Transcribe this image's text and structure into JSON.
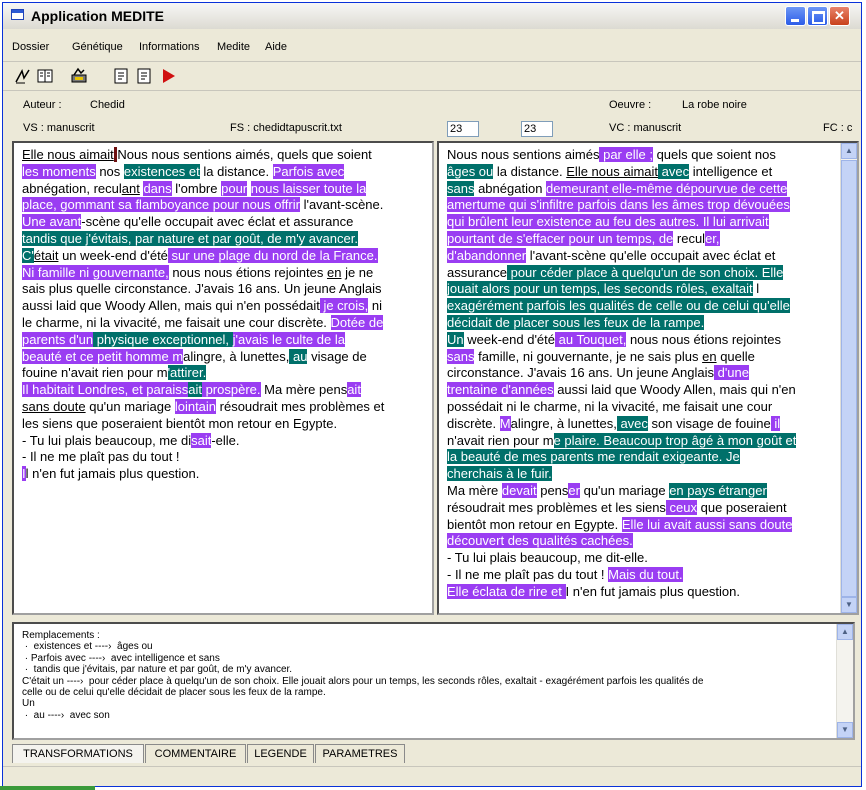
{
  "window": {
    "title": "Application MEDITE",
    "controls": [
      "_",
      "□",
      "X"
    ]
  },
  "menu": [
    "Dossier",
    "Génétique",
    "Informations",
    "Medite",
    "Aide"
  ],
  "toolbar": [
    "tool-align",
    "tool-book",
    "tool-wrench",
    "tool-doc-a",
    "tool-doc-b",
    "play-icon"
  ],
  "info": {
    "auteur_label": "Auteur :",
    "auteur_value": "Chedid",
    "oeuvre_label": "Oeuvre :",
    "oeuvre_value": "La robe noire",
    "vs": "VS : manuscrit",
    "fs": "FS : chedidtapuscrit.txt",
    "input1": "23",
    "input2": "23",
    "vc": "VC : manuscrit",
    "fc": "FC : c"
  },
  "colors": {
    "purple": "#9a3df2",
    "teal": "#00706a"
  },
  "left_text": [
    [
      [
        "Elle nous aimait",
        "u"
      ],
      [
        " ",
        "h"
      ],
      [
        "Nous nous sentions aimés, quels que soient",
        ""
      ]
    ],
    [
      [
        "les moments",
        "p"
      ],
      [
        " nos ",
        ""
      ],
      [
        "existences et",
        "t"
      ],
      [
        " la distance. ",
        ""
      ],
      [
        "Parfois avec",
        "p"
      ]
    ],
    [
      [
        "abnégation, recul",
        ""
      ],
      [
        "ant",
        "u"
      ],
      [
        " ",
        ""
      ],
      [
        "dans",
        "p"
      ],
      [
        " l'ombre ",
        ""
      ],
      [
        "pour",
        "p"
      ],
      [
        " ",
        ""
      ],
      [
        "nous laisser toute la",
        "p"
      ]
    ],
    [
      [
        "place, gommant sa flamboyance pour nous offrir",
        "p"
      ],
      [
        " l'avant-scène.",
        ""
      ]
    ],
    [
      [
        "Une avant",
        "p"
      ],
      [
        "-scène qu'elle occupait avec éclat et assurance",
        ""
      ]
    ],
    [
      [
        "tandis que j'évitais, par nature et par goût, de m'y avancer.",
        "t"
      ]
    ],
    [
      [
        "C'",
        "t"
      ],
      [
        "était",
        "u"
      ],
      [
        " un",
        ""
      ],
      [
        " week-end d'été",
        ""
      ],
      [
        " sur une plage du nord de la France.",
        "p"
      ]
    ],
    [
      [
        "Ni famille ni gouvernante,",
        "p"
      ],
      [
        " nous nous étions rejointes ",
        ""
      ],
      [
        "en",
        "u"
      ],
      [
        " je ne",
        ""
      ]
    ],
    [
      [
        "sais plus quelle circonstance. J'avais 16 ans. Un jeune Anglais",
        ""
      ]
    ],
    [
      [
        "aussi laid que Woody Allen, mais qui n'en possédait",
        ""
      ],
      [
        " je crois,",
        "p"
      ],
      [
        " ni",
        ""
      ]
    ],
    [
      [
        "le charme, ni la vivacité, me faisait une cour discrète. ",
        ""
      ],
      [
        "Dotée de",
        "p"
      ]
    ],
    [
      [
        "parents d'un",
        "p"
      ],
      [
        " physique exceptionnel, ",
        "t"
      ],
      [
        "j'avais le culte de la",
        "p"
      ]
    ],
    [
      [
        "beauté et ce petit homme m",
        "p"
      ],
      [
        "alingre, à lunettes,",
        ""
      ],
      [
        " au",
        "t"
      ],
      [
        " visage de",
        ""
      ]
    ],
    [
      [
        "fouine n'avait rien pour m",
        ""
      ],
      [
        "'attirer.",
        "t"
      ]
    ],
    [
      [
        "Il habitait Londres, et paraiss",
        "p"
      ],
      [
        "ait",
        "t"
      ],
      [
        " prospère.",
        "p"
      ],
      [
        " Ma mère pens",
        ""
      ],
      [
        "ait",
        "p"
      ]
    ],
    [
      [
        "sans doute",
        "u"
      ],
      [
        " qu'un mariage ",
        ""
      ],
      [
        "lointain",
        "p"
      ],
      [
        " résoudrait mes problèmes et",
        ""
      ]
    ],
    [
      [
        "les siens que poseraient bientôt mon retour en Egypte.",
        ""
      ]
    ],
    [
      [
        "- Tu lui plais beaucoup, me di",
        ""
      ],
      [
        "sait",
        "p"
      ],
      [
        "-elle.",
        ""
      ]
    ],
    [
      [
        "- Il ne me plaît pas du tout !",
        ""
      ]
    ],
    [
      [
        "I",
        "p"
      ],
      [
        "l n'en fut jamais plus question.",
        ""
      ]
    ]
  ],
  "right_text": [
    [
      [
        "Nous nous sentions aimés",
        ""
      ],
      [
        " par elle ;",
        "p"
      ],
      [
        " quels que soient nos",
        ""
      ]
    ],
    [
      [
        "âges ou",
        "t"
      ],
      [
        " la distance. ",
        ""
      ],
      [
        "Elle nous aimait",
        "u"
      ],
      [
        " avec",
        "t"
      ],
      [
        " intelligence et",
        ""
      ]
    ],
    [
      [
        "sans",
        "t"
      ],
      [
        " abnégation ",
        ""
      ],
      [
        "demeurant elle-même dépourvue de cette",
        "p"
      ]
    ],
    [
      [
        "amertume qui s'infiltre parfois dans les âmes trop dévouées",
        "p"
      ]
    ],
    [
      [
        "qui brûlent leur existence au feu des autres. Il lui arrivait",
        "p"
      ]
    ],
    [
      [
        "pourtant de s'effacer pour un temps, de",
        "p"
      ],
      [
        " recul",
        ""
      ],
      [
        "er,",
        "p"
      ]
    ],
    [
      [
        "d'abandonner",
        "p"
      ],
      [
        " l'avant-scène qu'elle occupait avec éclat et",
        ""
      ]
    ],
    [
      [
        "assurance",
        ""
      ],
      [
        " pour céder place à quelqu'un de son choix. Elle",
        "t"
      ]
    ],
    [
      [
        "jouait alors pour un temps, les seconds rôles, exaltait",
        "t"
      ],
      [
        " l",
        ""
      ]
    ],
    [
      [
        "exagérément parfois les qualités de celle ou de celui qu'elle",
        "t"
      ]
    ],
    [
      [
        "décidait de placer sous les feux de la rampe.",
        "t"
      ]
    ],
    [
      [
        "Un",
        "t"
      ],
      [
        " week-end d'été",
        ""
      ],
      [
        " au Touquet,",
        "p"
      ],
      [
        " nous nous étions rejointes",
        ""
      ]
    ],
    [
      [
        "sans",
        "p"
      ],
      [
        " famille, ni gouvernante,",
        ""
      ],
      [
        " je ne sais plus ",
        ""
      ],
      [
        "en",
        "u"
      ],
      [
        " quelle",
        ""
      ]
    ],
    [
      [
        "circonstance. J'avais 16 ans. Un jeune Anglais",
        ""
      ],
      [
        " d'une",
        "p"
      ]
    ],
    [
      [
        "trentaine d'années",
        "p"
      ],
      [
        " aussi laid que Woody Allen, mais qui n'en",
        ""
      ]
    ],
    [
      [
        "possédait ni le charme, ni la vivacité, me faisait une cour",
        ""
      ]
    ],
    [
      [
        "discrète. ",
        ""
      ],
      [
        "M",
        "p"
      ],
      [
        "alingre, à lunettes,",
        ""
      ],
      [
        " avec",
        "t"
      ],
      [
        " son visage de fouine",
        ""
      ],
      [
        " il",
        "p"
      ]
    ],
    [
      [
        "n'avait rien pour m",
        ""
      ],
      [
        "e plaire. Beaucoup trop âgé à mon goût et",
        "t"
      ]
    ],
    [
      [
        "la beauté de mes parents me rendait exigeante. Je",
        "t"
      ]
    ],
    [
      [
        "cherchais à le fuir.",
        "t"
      ]
    ],
    [
      [
        "Ma mère ",
        ""
      ],
      [
        "devait",
        "p"
      ],
      [
        " pens",
        ""
      ],
      [
        "er",
        "p"
      ],
      [
        " qu'un mariage ",
        ""
      ],
      [
        "en pays étranger",
        "t"
      ]
    ],
    [
      [
        "résoudrait",
        ""
      ],
      [
        " mes problèmes et les siens",
        ""
      ],
      [
        " ceux",
        "p"
      ],
      [
        " que poseraient",
        ""
      ]
    ],
    [
      [
        "bientôt mon retour en Egypte. ",
        ""
      ],
      [
        "Elle lui avait aussi sans doute",
        "p"
      ]
    ],
    [
      [
        "découvert des qualités cachées.",
        "p"
      ]
    ],
    [
      [
        "- Tu lui plais beaucoup, me dit-elle.",
        ""
      ]
    ],
    [
      [
        "- Il ne me plaît pas du tout ! ",
        ""
      ],
      [
        "Mais du tout.",
        "p"
      ]
    ],
    [
      [
        "Elle éclata de rire et ",
        "p"
      ],
      [
        "I",
        ""
      ],
      [
        " n'en fut jamais plus question.",
        ""
      ]
    ]
  ],
  "replacements": "Remplacements :\n ·  existences et ----›  âges ou\n · Parfois avec ----›  avec intelligence et sans\n ·  tandis que j'évitais, par nature et par goût, de m'y avancer.\nC'était un ----›  pour céder place à quelqu'un de son choix. Elle jouait alors pour un temps, les seconds rôles, exaltait - exagérément parfois les qualités de\ncelle ou de celui qu'elle décidait de placer sous les feux de la rampe.\nUn\n ·  au ----›  avec son",
  "tabs": [
    "TRANSFORMATIONS",
    "COMMENTAIRE",
    "LEGENDE",
    "PARAMETRES"
  ]
}
